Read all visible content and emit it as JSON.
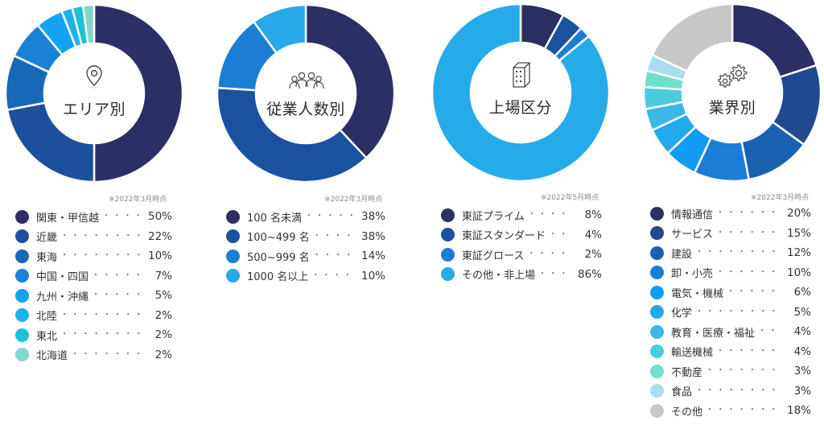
{
  "chart_data": [
    {
      "type": "pie",
      "subtype": "donut",
      "title": "エリア別",
      "icon": "location-pin-icon",
      "note": "※2022年3月時点",
      "categories": [
        "関東・甲信越",
        "近畿",
        "東海",
        "中国・四国",
        "九州・沖縄",
        "北陸",
        "東北",
        "北海道"
      ],
      "values": [
        50,
        22,
        10,
        7,
        5,
        2,
        2,
        2
      ],
      "labels": [
        "50%",
        "22%",
        "10%",
        "7%",
        "5%",
        "2%",
        "2%",
        "2%"
      ],
      "colors": [
        "#2b2f63",
        "#1e4f9c",
        "#1868b8",
        "#1a82d6",
        "#13a3f0",
        "#1cb3e8",
        "#1ec0d8",
        "#80d9cc"
      ],
      "legend": "bottom",
      "unit": "%"
    },
    {
      "type": "pie",
      "subtype": "donut",
      "title": "従業人数別",
      "icon": "people-group-icon",
      "note": "※2022年3月時点",
      "categories": [
        "100 名未満",
        "100~499 名",
        "500~999 名",
        "1000 名以上"
      ],
      "values": [
        38,
        38,
        14,
        10
      ],
      "labels": [
        "38%",
        "38%",
        "14%",
        "10%"
      ],
      "colors": [
        "#2b2f63",
        "#1a52a0",
        "#1b7ed4",
        "#29a8e8"
      ],
      "legend": "bottom",
      "unit": "%"
    },
    {
      "type": "pie",
      "subtype": "donut",
      "title": "上場区分",
      "icon": "building-icon",
      "note": "※2022年5月時点",
      "categories": [
        "東証プライム",
        "東証スタンダード",
        "東証グロース",
        "その他・非上場"
      ],
      "values": [
        8,
        4,
        2,
        86
      ],
      "labels": [
        "8%",
        "4%",
        "2%",
        "86%"
      ],
      "colors": [
        "#2b2f63",
        "#1a52a0",
        "#1b7ed4",
        "#26abea"
      ],
      "legend": "bottom",
      "unit": "%"
    },
    {
      "type": "pie",
      "subtype": "donut",
      "title": "業界別",
      "icon": "gears-icon",
      "note": "※2022年3月時点",
      "categories": [
        "情報通信",
        "サービス",
        "建設",
        "卸・小売",
        "電気・機械",
        "化学",
        "教育・医療・福祉",
        "輸送機械",
        "不動産",
        "食品",
        "その他"
      ],
      "values": [
        20,
        15,
        12,
        10,
        6,
        5,
        4,
        4,
        3,
        3,
        18
      ],
      "labels": [
        "20%",
        "15%",
        "12%",
        "10%",
        "6%",
        "5%",
        "4%",
        "4%",
        "3%",
        "3%",
        "18%"
      ],
      "colors": [
        "#2b2f63",
        "#1f4a8f",
        "#1a62b0",
        "#1a7ed6",
        "#0f9cf2",
        "#23a8ec",
        "#3bb8e6",
        "#4ccbdc",
        "#6ee0cc",
        "#a8def0",
        "#c8c8c8"
      ],
      "legend": "bottom",
      "unit": "%"
    }
  ]
}
